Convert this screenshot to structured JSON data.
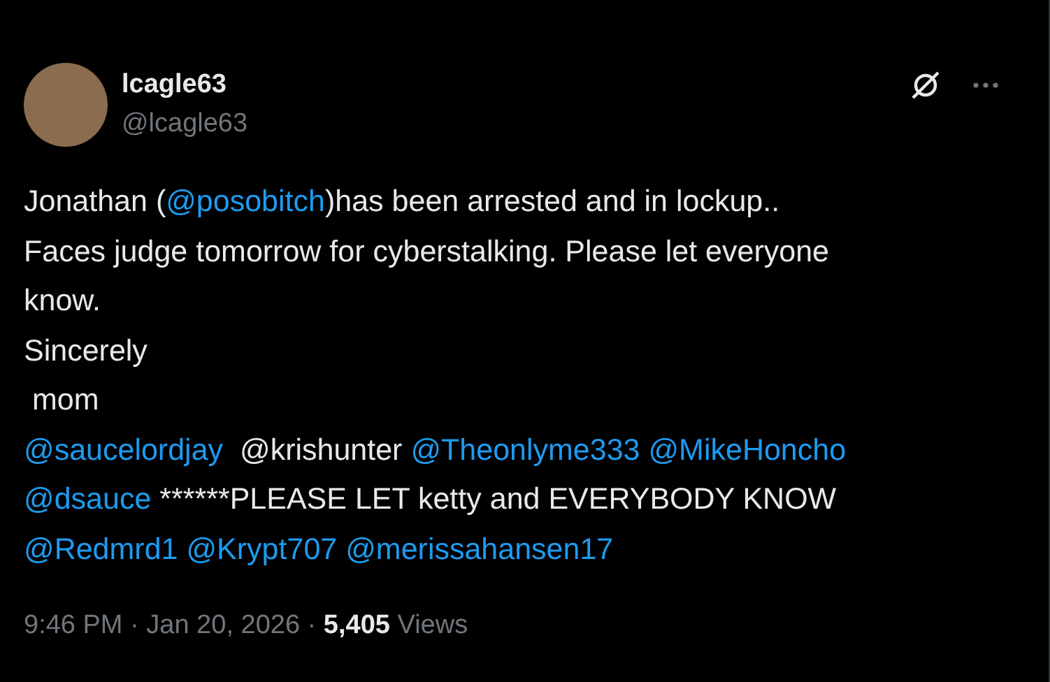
{
  "author": {
    "name": "lcagle63",
    "handle": "@lcagle63"
  },
  "body": [
    [
      {
        "kind": "text",
        "text": "Jonathan ("
      },
      {
        "kind": "mention",
        "text": "@posobitch"
      },
      {
        "kind": "text",
        "text": ")has been arrested and in lockup.."
      }
    ],
    [
      {
        "kind": "text",
        "text": "Faces judge tomorrow for cyberstalking. Please let everyone"
      }
    ],
    [
      {
        "kind": "text",
        "text": "know."
      }
    ],
    [
      {
        "kind": "text",
        "text": "Sincerely"
      }
    ],
    [
      {
        "kind": "text",
        "text": " mom"
      }
    ],
    [
      {
        "kind": "mention",
        "text": "@saucelordjay"
      },
      {
        "kind": "text",
        "text": "  @krishunter "
      },
      {
        "kind": "mention",
        "text": "@Theonlyme333 "
      },
      {
        "kind": "mention",
        "text": "@MikeHoncho"
      }
    ],
    [
      {
        "kind": "mention",
        "text": "@dsauce"
      },
      {
        "kind": "text",
        "text": " ******PLEASE LET ketty and EVERYBODY KNOW"
      }
    ],
    [
      {
        "kind": "mention",
        "text": "@Redmrd1  "
      },
      {
        "kind": "mention",
        "text": "@Krypt707 "
      },
      {
        "kind": "mention",
        "text": "@merissahansen17"
      }
    ]
  ],
  "meta": {
    "timestamp": "9:46 PM · Jan 20, 2026 · ",
    "views_count": "5,405",
    "views_label": "Views"
  }
}
